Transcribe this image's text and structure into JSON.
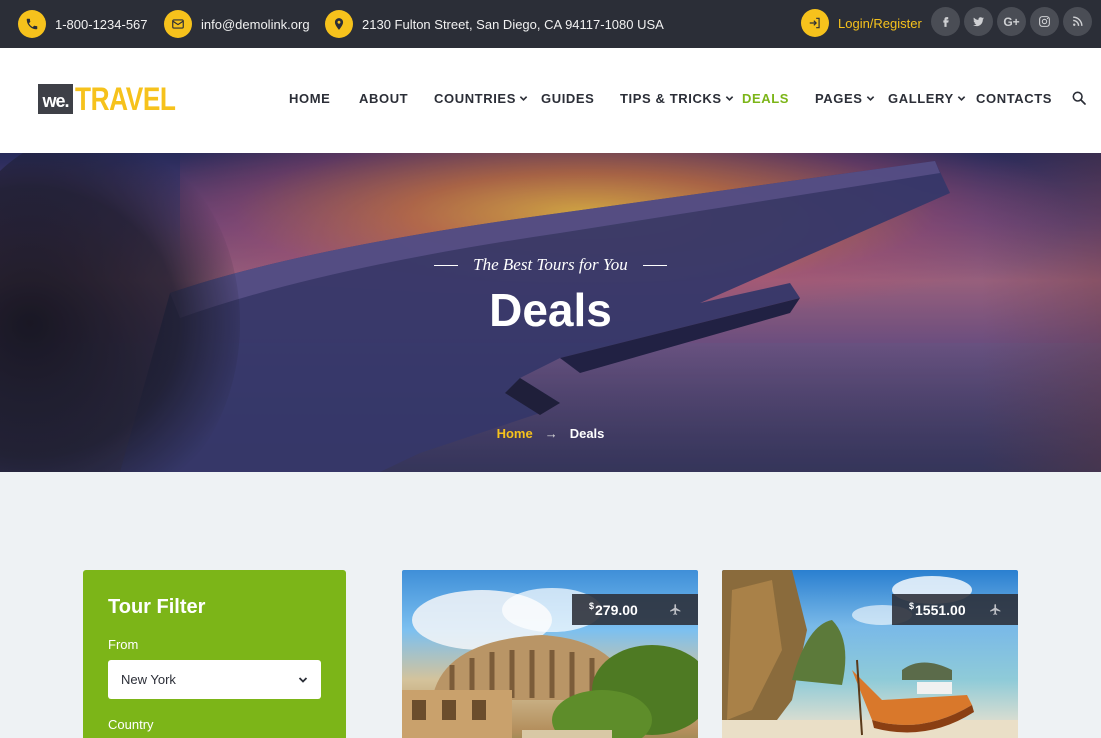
{
  "topbar": {
    "phone": "1-800-1234-567",
    "email": "info@demolink.org",
    "address": "2130 Fulton Street, San Diego, CA 94117-1080 USA",
    "login": "Login/Register",
    "socials": [
      "facebook-icon",
      "twitter-icon",
      "google-plus-icon",
      "instagram-icon",
      "rss-icon"
    ]
  },
  "brand": {
    "we": "we.",
    "travel": "TRAVEL"
  },
  "nav": {
    "home": "HOME",
    "about": "ABOUT",
    "countries": "COUNTRIES",
    "guides": "GUIDES",
    "tips": "TIPS & TRICKS",
    "deals": "DEALS",
    "pages": "PAGES",
    "gallery": "GALLERY",
    "contacts": "CONTACTS"
  },
  "hero": {
    "subtitle": "The Best Tours for You",
    "title": "Deals",
    "breadcrumb_home": "Home",
    "breadcrumb_current": "Deals"
  },
  "filter": {
    "title": "Tour Filter",
    "from_label": "From",
    "from_value": "New York",
    "country_label": "Country"
  },
  "cards": [
    {
      "currency": "$",
      "price": "279.00"
    },
    {
      "currency": "$",
      "price": "1551.00"
    }
  ],
  "colors": {
    "accent": "#f6c21c",
    "green": "#7cb518",
    "dark": "#2b2e37"
  }
}
